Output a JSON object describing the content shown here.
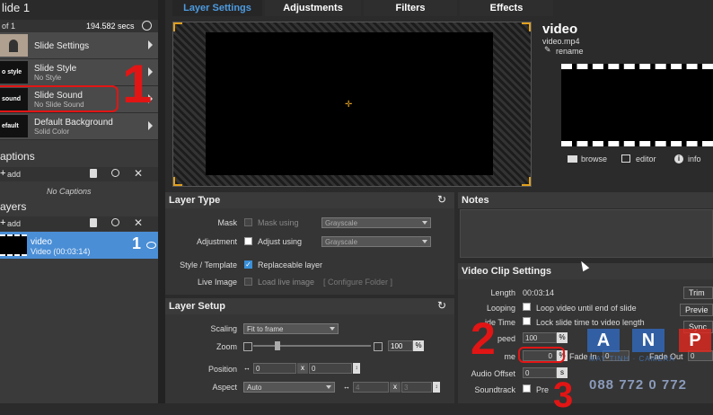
{
  "left": {
    "title": "lide 1",
    "count": "of 1",
    "duration": "194.582 secs",
    "items": [
      {
        "thumb": "",
        "title": "Slide Settings",
        "sub": ""
      },
      {
        "thumb": "o style",
        "title": "Slide Style",
        "sub": "No Style"
      },
      {
        "thumb": "sound",
        "title": "Slide Sound",
        "sub": "No Slide Sound"
      },
      {
        "thumb": "efault",
        "title": "Default Background",
        "sub": "Solid Color"
      }
    ],
    "captions_title": "aptions",
    "captions_add": "add",
    "captions_empty": "No Captions",
    "layers_title": "ayers",
    "layers_add": "add",
    "layer": {
      "name": "video",
      "sub": "Video (00:03:14)",
      "number": "1"
    }
  },
  "tabs": [
    "Layer Settings",
    "Adjustments",
    "Filters",
    "Effects"
  ],
  "preview": {
    "title": "video",
    "file": "video.mp4",
    "rename": "rename",
    "browse": "browse",
    "editor": "editor",
    "info": "info"
  },
  "layer_type": {
    "title": "Layer Type",
    "mask_label": "Mask",
    "mask_check": "Mask using",
    "mask_select": "Grayscale",
    "adjust_label": "Adjustment",
    "adjust_check": "Adjust using",
    "adjust_select": "Grayscale",
    "style_label": "Style / Template",
    "style_check": "Replaceable layer",
    "live_label": "Live Image",
    "live_check": "Load live image",
    "live_button": "[ Configure Folder ]"
  },
  "layer_setup": {
    "title": "Layer Setup",
    "scaling_label": "Scaling",
    "scaling_value": "Fit to frame",
    "zoom_label": "Zoom",
    "zoom_value": "100",
    "zoom_unit": "%",
    "position_label": "Position",
    "pos_x": "0",
    "pos_x_sep": "x",
    "pos_y": "0",
    "aspect_label": "Aspect",
    "aspect_value": "Auto",
    "aspect_w": "4",
    "aspect_sep": "x",
    "aspect_h": "3"
  },
  "notes": {
    "title": "Notes"
  },
  "clip": {
    "title": "Video Clip Settings",
    "length_label": "Length",
    "length_value": "00:03:14",
    "looping_label": "Looping",
    "looping_check": "Loop video until end of slide",
    "slidetime_label": "ide Time",
    "slidetime_check": "Lock slide time to video length",
    "speed_label": "peed",
    "speed_value": "100",
    "speed_unit": "%",
    "volume_label": "me",
    "volume_value": "0",
    "volume_unit": "%",
    "fadein_label": "Fade In",
    "fadein_value": "0",
    "fadeout_label": "Fade Out",
    "fadeout_value": "0",
    "audio_label": "Audio Offset",
    "audio_value": "0",
    "audio_unit": "s",
    "soundtrack_label": "Soundtrack",
    "soundtrack_check": "Pre",
    "btn_trim": "Trim",
    "btn_preview": "Previe",
    "btn_sync": "Sync T"
  },
  "annotations": {
    "n1": "1",
    "n2": "2",
    "n3": "3"
  },
  "watermark": {
    "letters": [
      "A",
      "N",
      "P"
    ],
    "sub": "MAY TINH · CAMERA",
    "phone": "088 772 0 772"
  },
  "colors": {
    "accent": "#3a8fd8",
    "selected": "#4a8ed6",
    "tab_active": "#4d9be0",
    "annotation": "#e21515"
  }
}
